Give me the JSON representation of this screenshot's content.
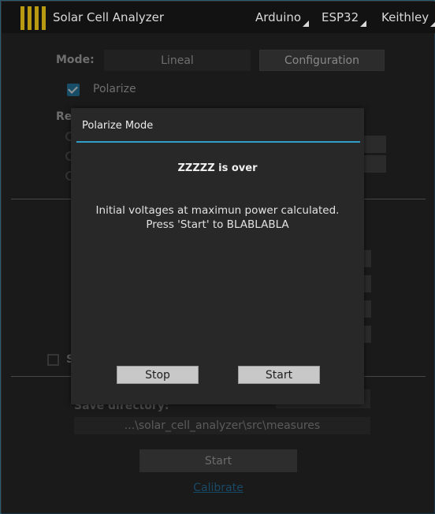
{
  "app": {
    "title": "Solar Cell Analyzer",
    "menus": [
      "Arduino",
      "ESP32",
      "Keithley"
    ]
  },
  "main": {
    "mode_label": "Mode:",
    "mode_tabs": [
      "Lineal",
      "Configuration"
    ],
    "polarize_label": "Polarize",
    "polarize_checked": true,
    "section_partial_label": "Re",
    "s_partial_label": "S",
    "save_directory_label": "Save directory:",
    "save_directory_value": "...\\solar_cell_analyzer\\src\\measures",
    "start_label": "Start",
    "calibrate_label": "Calibrate"
  },
  "dialog": {
    "title": "Polarize Mode",
    "heading": "ZZZZZ is over",
    "message": "Initial voltages at maximun power calculated. Press 'Start' to BLABLABLA",
    "stop_label": "Stop",
    "start_label": "Start"
  },
  "colors": {
    "accent": "#2f9fc9",
    "logo": "#b89a12",
    "link": "#2a7fb0"
  }
}
